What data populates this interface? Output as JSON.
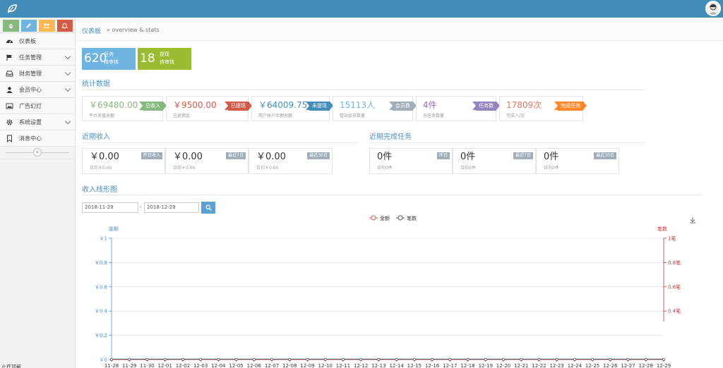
{
  "header": {
    "logo_icon": "leaf-icon",
    "avatar_icon": "user-avatar-icon"
  },
  "sidebar": {
    "shortcut_buttons": [
      {
        "icon": "home-icon",
        "color": "#87b87f"
      },
      {
        "icon": "pencil-icon",
        "color": "#6fb3e0"
      },
      {
        "icon": "users-icon",
        "color": "#ffb752"
      },
      {
        "icon": "bell-icon",
        "color": "#d15b47"
      }
    ],
    "items": [
      {
        "label": "仪表板",
        "icon": "dashboard-icon",
        "has_submenu": false
      },
      {
        "label": "任务管理",
        "icon": "flag-icon",
        "has_submenu": true
      },
      {
        "label": "财务管理",
        "icon": "inbox-icon",
        "has_submenu": true
      },
      {
        "label": "会员中心",
        "icon": "user-icon",
        "has_submenu": true
      },
      {
        "label": "广告幻灯",
        "icon": "picture-icon",
        "has_submenu": false
      },
      {
        "label": "系统设置",
        "icon": "gear-icon",
        "has_submenu": true
      },
      {
        "label": "消息中心",
        "icon": "bookmark-icon",
        "has_submenu": false
      }
    ],
    "collapse_label": "«",
    "footer_text": "正在加载"
  },
  "breadcrumb": {
    "home": "仪表板",
    "sub": "» overview & stats"
  },
  "tiles": [
    {
      "number": "620",
      "line1": "任务",
      "line2": "待审核",
      "color": "#6fb3e0"
    },
    {
      "number": "18",
      "line1": "提现",
      "line2": "待审核",
      "color": "#9abc32"
    }
  ],
  "stats": {
    "title": "统计数据",
    "boxes": [
      {
        "value": "￥69480.00",
        "caption": "平台充值总额",
        "tag": "总收入",
        "color": "#87b87f"
      },
      {
        "value": "￥9500.00",
        "caption": "已返佣金",
        "tag": "已提现",
        "color": "#d15b47"
      },
      {
        "value": "￥64009.75",
        "caption": "用户账户余额总额",
        "tag": "未提现",
        "color": "#438eb9"
      },
      {
        "value": "15113人",
        "caption": "整站会员数量",
        "tag": "会员数",
        "color": "#6fb3e0",
        "tagcolor": "#a0aeb9"
      },
      {
        "value": "4件",
        "caption": "总任务数量",
        "tag": "任务数",
        "color": "#a069c3",
        "tagcolor": "#9585bf"
      },
      {
        "value": "17809次",
        "caption": "完成人/次",
        "tag": "完成任务",
        "color": "#e2755f",
        "tagcolor": "#ff892a"
      }
    ]
  },
  "income": {
    "title": "近期收入",
    "boxes": [
      {
        "value": "￥0.00",
        "caption": "日均￥0.00",
        "tag": "昨日收入"
      },
      {
        "value": "￥0.00",
        "caption": "日均￥0.00",
        "tag": "最近7日"
      },
      {
        "value": "￥0.00",
        "caption": "日均￥0.00",
        "tag": "最近30日"
      }
    ]
  },
  "tasks": {
    "title": "近期完成任务",
    "boxes": [
      {
        "value": "0件",
        "caption": "日均0件",
        "tag": "昨日"
      },
      {
        "value": "0件",
        "caption": "日均0件",
        "tag": "最近7日"
      },
      {
        "value": "0件",
        "caption": "日均0件",
        "tag": "最近30日"
      }
    ]
  },
  "chart_section": {
    "title": "收入线形图",
    "date_from": "2018-11-29",
    "separator": "-",
    "date_to": "2018-12-29",
    "search_icon": "search-icon",
    "download_icon": "download-icon"
  },
  "chart_data": {
    "type": "line",
    "legend": [
      "金额",
      "笔数"
    ],
    "legend_position": "top-center",
    "series": [
      {
        "name": "金额",
        "color": "#d9534f",
        "values": [
          0,
          0,
          0,
          0,
          0,
          0,
          0,
          0,
          0,
          0,
          0,
          0,
          0,
          0,
          0,
          0,
          0,
          0,
          0,
          0,
          0,
          0,
          0,
          0,
          0,
          0,
          0,
          0,
          0,
          0,
          0,
          0
        ]
      },
      {
        "name": "笔数",
        "color": "#4a5a6a",
        "values": [
          0,
          0,
          0,
          0,
          0,
          0,
          0,
          0,
          0,
          0,
          0,
          0,
          0,
          0,
          0,
          0,
          0,
          0,
          0,
          0,
          0,
          0,
          0,
          0,
          0,
          0,
          0,
          0,
          0,
          0,
          0,
          0
        ]
      }
    ],
    "x": [
      "11-28",
      "11-29",
      "11-30",
      "12-01",
      "12-02",
      "12-03",
      "12-04",
      "12-05",
      "12-06",
      "12-07",
      "12-08",
      "12-09",
      "12-10",
      "12-11",
      "12-12",
      "12-13",
      "12-14",
      "12-15",
      "12-16",
      "12-17",
      "12-18",
      "12-19",
      "12-20",
      "12-21",
      "12-22",
      "12-23",
      "12-24",
      "12-25",
      "12-26",
      "12-27",
      "12-28",
      "12-29"
    ],
    "y_left": {
      "label": "金额",
      "ticks": [
        "￥0",
        "￥0.2",
        "￥0.4",
        "￥0.6",
        "￥0.8",
        "￥1"
      ],
      "range": [
        0,
        1
      ],
      "color": "#4a90d9"
    },
    "y_right": {
      "label": "笔数",
      "ticks": [
        "0.4笔",
        "0.6笔",
        "0.8笔",
        "1笔"
      ],
      "range": [
        0,
        1
      ],
      "color": "#c23531"
    },
    "grid": true
  }
}
